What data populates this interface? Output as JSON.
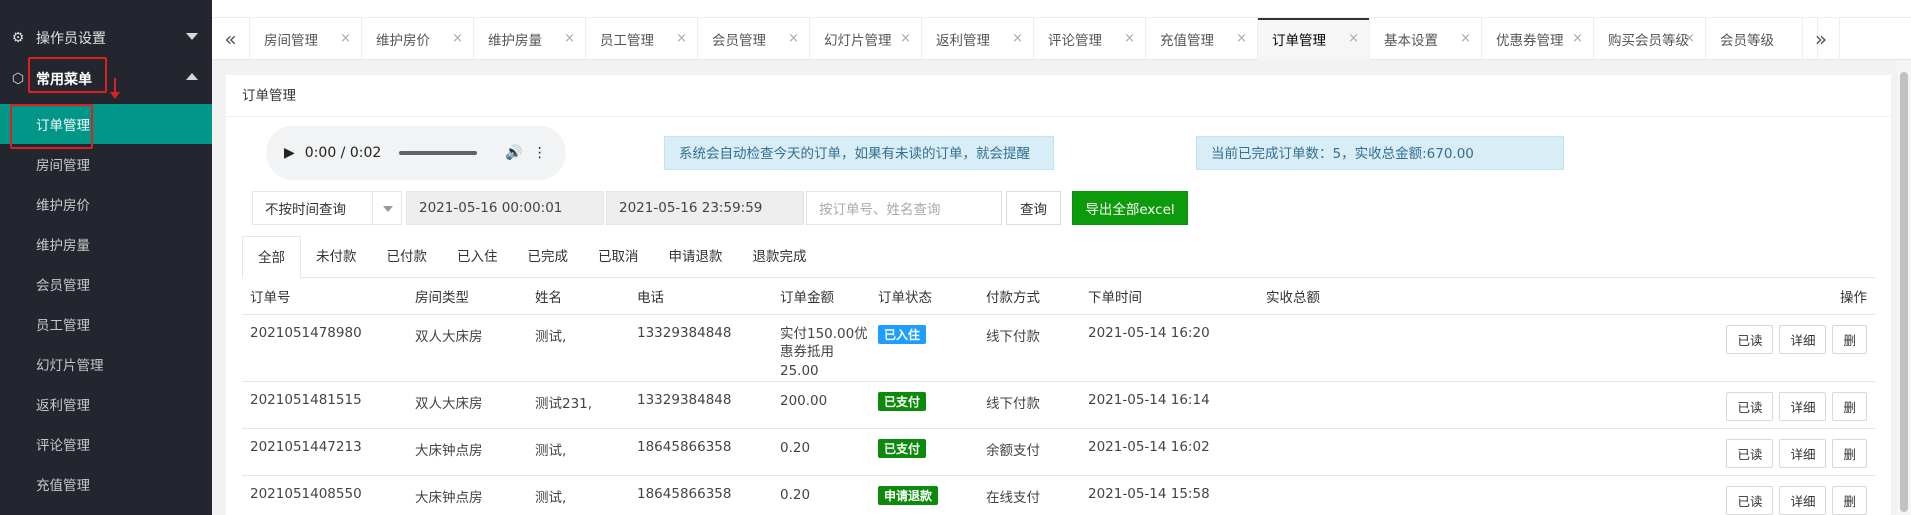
{
  "sidebar": {
    "groups": [
      {
        "label": "操作员设置",
        "icon": "gear-icon"
      },
      {
        "label": "常用菜单",
        "icon": "cube-icon"
      }
    ],
    "items": [
      {
        "label": "订单管理"
      },
      {
        "label": "房间管理"
      },
      {
        "label": "维护房价"
      },
      {
        "label": "维护房量"
      },
      {
        "label": "会员管理"
      },
      {
        "label": "员工管理"
      },
      {
        "label": "幻灯片管理"
      },
      {
        "label": "返利管理"
      },
      {
        "label": "评论管理"
      },
      {
        "label": "充值管理"
      }
    ]
  },
  "tabs": [
    {
      "label": "房间管理"
    },
    {
      "label": "维护房价"
    },
    {
      "label": "维护房量"
    },
    {
      "label": "员工管理"
    },
    {
      "label": "会员管理"
    },
    {
      "label": "幻灯片管理"
    },
    {
      "label": "返利管理"
    },
    {
      "label": "评论管理"
    },
    {
      "label": "充值管理"
    },
    {
      "label": "订单管理"
    },
    {
      "label": "基本设置"
    },
    {
      "label": "优惠券管理"
    },
    {
      "label": "购买会员等级"
    },
    {
      "label": "会员等级"
    }
  ],
  "tab_close": "×",
  "nav": {
    "prev": "«",
    "next": "»"
  },
  "card": {
    "title": "订单管理",
    "audio_time": "0:00 / 0:02",
    "notice": "系统会自动检查今天的订单，如果有未读的订单，就会提醒",
    "summary": "当前已完成订单数：5，实收总金额:670.00"
  },
  "filters": {
    "time_mode": "不按时间查询",
    "start": "2021-05-16 00:00:01",
    "end": "2021-05-16 23:59:59",
    "search_placeholder": "按订单号、姓名查询",
    "query_label": "查询",
    "export_label": "导出全部excel"
  },
  "subtabs": [
    "全部",
    "未付款",
    "已付款",
    "已入住",
    "已完成",
    "已取消",
    "申请退款",
    "退款完成"
  ],
  "table": {
    "headers": [
      "订单号",
      "房间类型",
      "姓名",
      "电话",
      "订单金额",
      "订单状态",
      "付款方式",
      "下单时间",
      "实收总额",
      "操作"
    ],
    "rows": [
      {
        "id": "2021051478980",
        "room": "双人大床房",
        "name": "测试,",
        "phone": "13329384848",
        "amount": "实付150.00优惠券抵用25.00",
        "status": "已入住",
        "status_color": "#1e9fff",
        "pay": "线下付款",
        "time": "2021-05-14 16:20",
        "total": ""
      },
      {
        "id": "2021051481515",
        "room": "双人大床房",
        "name": "测试231,",
        "phone": "13329384848",
        "amount": "200.00",
        "status": "已支付",
        "status_color": "#0b8a0b",
        "pay": "线下付款",
        "time": "2021-05-14 16:14",
        "total": ""
      },
      {
        "id": "2021051447213",
        "room": "大床钟点房",
        "name": "测试,",
        "phone": "18645866358",
        "amount": "0.20",
        "status": "已支付",
        "status_color": "#0b8a0b",
        "pay": "余额支付",
        "time": "2021-05-14 16:02",
        "total": ""
      },
      {
        "id": "2021051408550",
        "room": "大床钟点房",
        "name": "测试,",
        "phone": "18645866358",
        "amount": "0.20",
        "status": "申请退款",
        "status_color": "#0b8a0b",
        "pay": "在线支付",
        "time": "2021-05-14 15:58",
        "total": ""
      }
    ],
    "ops": [
      "已读",
      "详细",
      "删"
    ]
  }
}
